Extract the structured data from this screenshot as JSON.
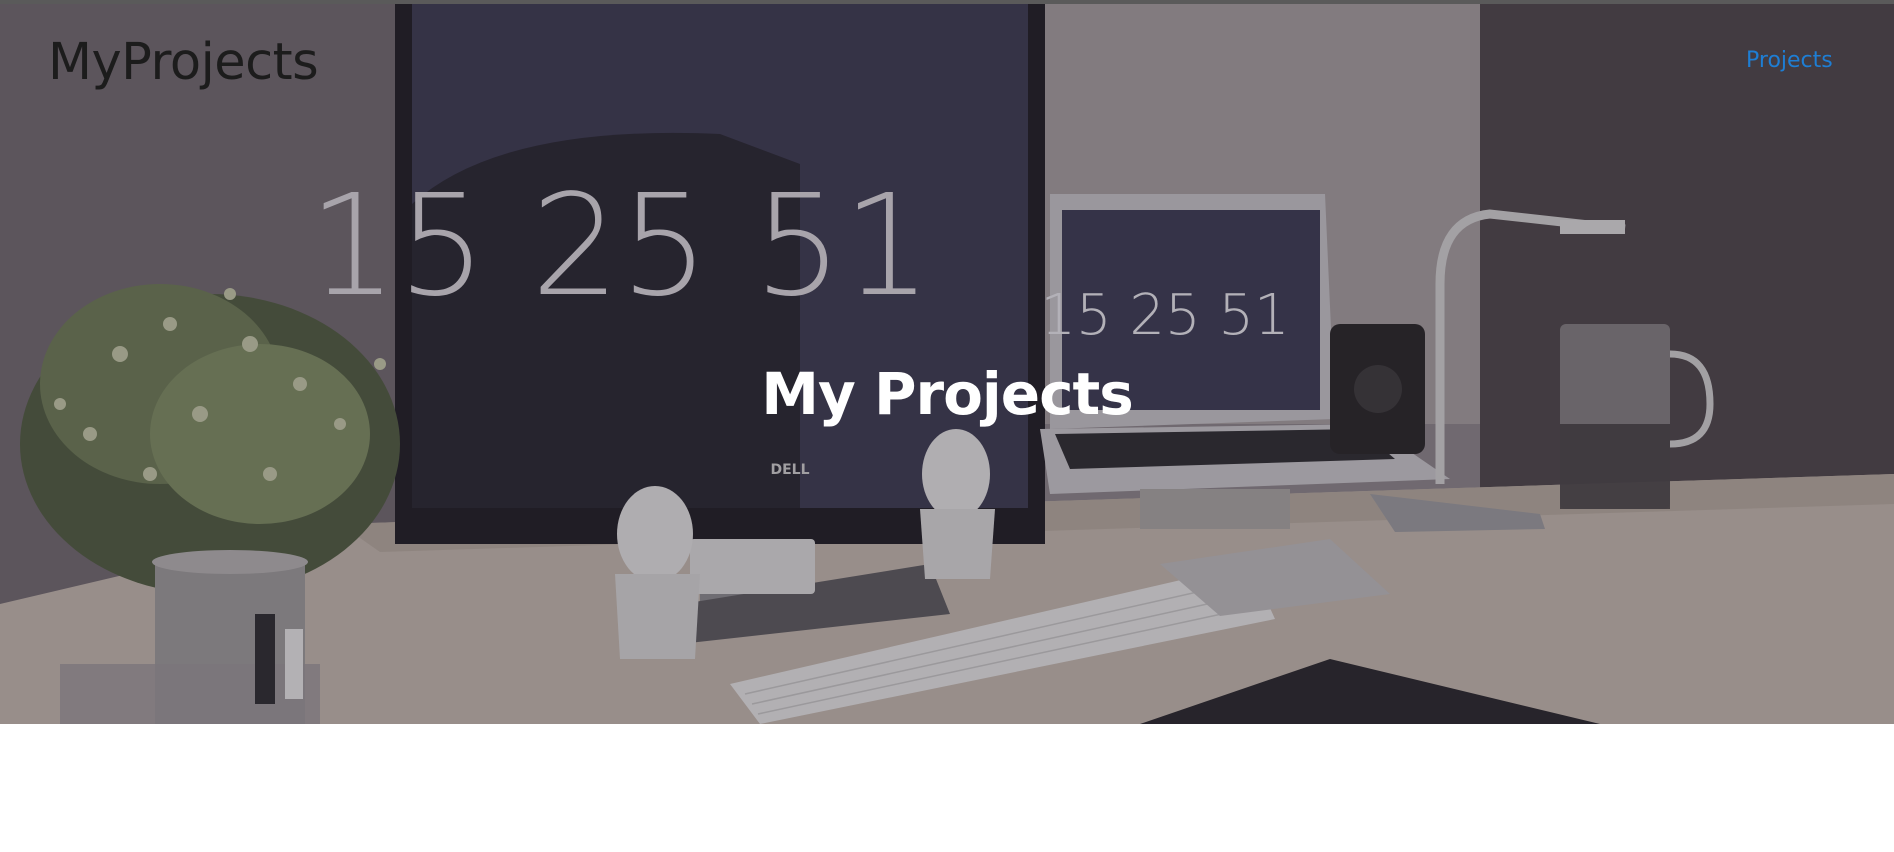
{
  "brand": {
    "title": "MyProjects"
  },
  "nav": {
    "items": [
      {
        "label": "Projects"
      }
    ]
  },
  "hero": {
    "title": "My Projects",
    "monitor_clock": "15 25 51",
    "laptop_clock": "15 25 51",
    "monitor_brand": "DELL"
  },
  "colors": {
    "nav_link": "#1e7ed4",
    "hero_title": "#ffffff",
    "brand_text": "#1c1c1c"
  }
}
